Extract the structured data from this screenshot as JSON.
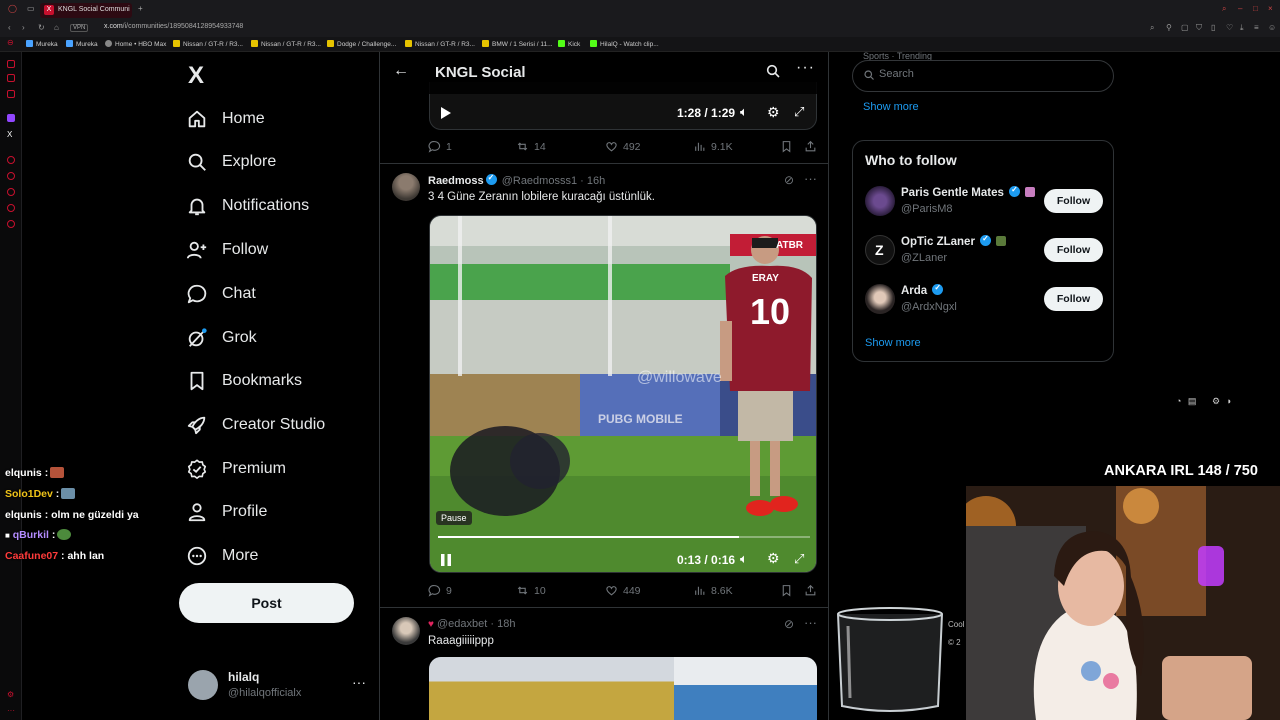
{
  "browser": {
    "tab_title": "KNGL Social Communi",
    "url_prefix": "x.com",
    "url_path": "/i/communities/1895084128954933748",
    "bookmarks": [
      "Mureka",
      "Mureka",
      "Home • HBO Max",
      "Nissan / GT-R / R3...",
      "Nissan / GT-R / R3...",
      "Dodge / Challenge...",
      "Nissan / GT-R / R3...",
      "BMW / 1 Serisi / 11...",
      "Kick",
      "HilalQ - Watch clip..."
    ]
  },
  "nav": {
    "logo": "X",
    "items": [
      "Home",
      "Explore",
      "Notifications",
      "Follow",
      "Chat",
      "Grok",
      "Bookmarks",
      "Creator Studio",
      "Premium",
      "Profile",
      "More"
    ],
    "post_label": "Post"
  },
  "account": {
    "name": "hilalq",
    "handle": "@hilalqofficialx",
    "menu": "···"
  },
  "chat": [
    {
      "user": "elqunis",
      "text": ":"
    },
    {
      "user": "Solo1Dev",
      "text": ":"
    },
    {
      "user": "elqunis",
      "text": ": olm ne güzeldi ya"
    },
    {
      "user": "qBurkil",
      "text": ":"
    },
    {
      "user": "Caafune07",
      "text": ": ahh lan"
    }
  ],
  "header": {
    "title": "KNGL Social"
  },
  "tweet1": {
    "video_time": "1:28 / 1:29",
    "replies": "1",
    "reposts": "14",
    "likes": "492",
    "views": "9.1K"
  },
  "tweet2": {
    "name": "Raedmoss",
    "handle": "@Raedmosss1",
    "time": "· 16h",
    "text": "3 4 Güne Zeranın lobilere kuracağı üstünlük.",
    "video_time": "0:13 / 0:16",
    "pause_tooltip": "Pause",
    "progress": 0.81,
    "watermark": "@willowave",
    "jersey_name": "ERAY",
    "jersey_number": "10",
    "banner": "PUBG MOBILE",
    "replies": "9",
    "reposts": "10",
    "likes": "449",
    "views": "8.6K"
  },
  "tweet3": {
    "handle": "@edaxbet",
    "time": "· 18h",
    "text": "Raaagiiiiippp"
  },
  "right": {
    "trending_cut": "Sports · Trending",
    "search_placeholder": "Search",
    "show_more_1": "Show more",
    "who_to_follow_title": "Who to follow",
    "suggestions": [
      {
        "name": "Paris Gentle Mates",
        "handle": "@ParisM8",
        "button": "Follow"
      },
      {
        "name": "OpTic ZLaner",
        "handle": "@ZLaner",
        "button": "Follow"
      },
      {
        "name": "Arda",
        "handle": "@ArdxNgxl",
        "button": "Follow"
      }
    ],
    "show_more_2": "Show more"
  },
  "stream": {
    "irl_label": "ANKARA IRL 148 / 750"
  },
  "colors": {
    "accent": "#1d9bf0",
    "background": "#000000",
    "border": "#2f3336",
    "muted": "#71767b",
    "browser_accent": "#c8102e"
  }
}
